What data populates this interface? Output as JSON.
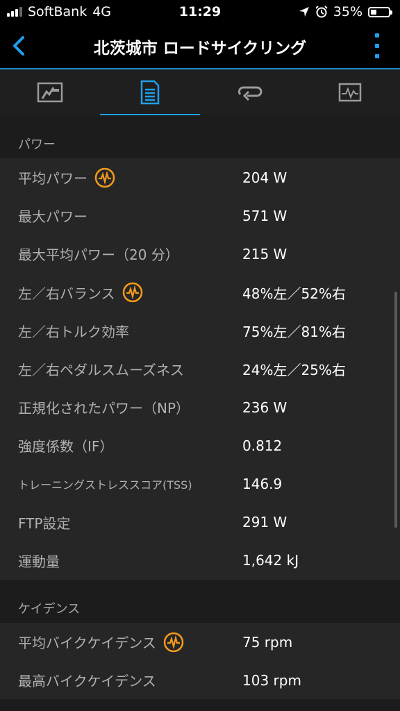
{
  "status_bar": {
    "carrier": "SoftBank",
    "network": "4G",
    "time": "11:29",
    "battery": "35%",
    "battery_level": 0.35
  },
  "nav": {
    "title": "北茨城市 ロードサイクリング",
    "back_icon": "chevron-left-icon",
    "more_icon": "vertical-dots-icon",
    "accent_color": "#1ea0f0"
  },
  "tabs": [
    {
      "icon": "map-overview-icon",
      "active": false
    },
    {
      "icon": "stats-list-icon",
      "active": true
    },
    {
      "icon": "laps-icon",
      "active": false
    },
    {
      "icon": "chart-icon",
      "active": false
    }
  ],
  "sections": {
    "power": {
      "header": "パワー",
      "rows": [
        {
          "label": "平均パワー",
          "value": "204 W"
        },
        {
          "label": "最大パワー",
          "value": "571 W"
        },
        {
          "label": "最大平均パワー（20 分）",
          "value": "215 W"
        },
        {
          "label": "左／右バランス",
          "value": "48%左／52%右"
        },
        {
          "label": "左／右トルク効率",
          "value": "75%左／81%右"
        },
        {
          "label": "左／右ペダルスムーズネス",
          "value": "24%左／25%右"
        },
        {
          "label": "正規化されたパワー（NP）",
          "value": "236 W"
        },
        {
          "label": "強度係数（IF）",
          "value": "0.812"
        },
        {
          "label": "トレーニングストレススコア(TSS)",
          "value": "146.9"
        },
        {
          "label": "FTP設定",
          "value": "291 W"
        },
        {
          "label": "運動量",
          "value": "1,642 kJ"
        }
      ]
    },
    "cadence": {
      "header": "ケイデンス",
      "rows": [
        {
          "label": "平均バイクケイデンス",
          "value": "75 rpm"
        },
        {
          "label": "最高バイクケイデンス",
          "value": "103 rpm"
        }
      ]
    }
  },
  "badge_icon": "activity-wave-icon",
  "badge_color": "#f59a1b"
}
